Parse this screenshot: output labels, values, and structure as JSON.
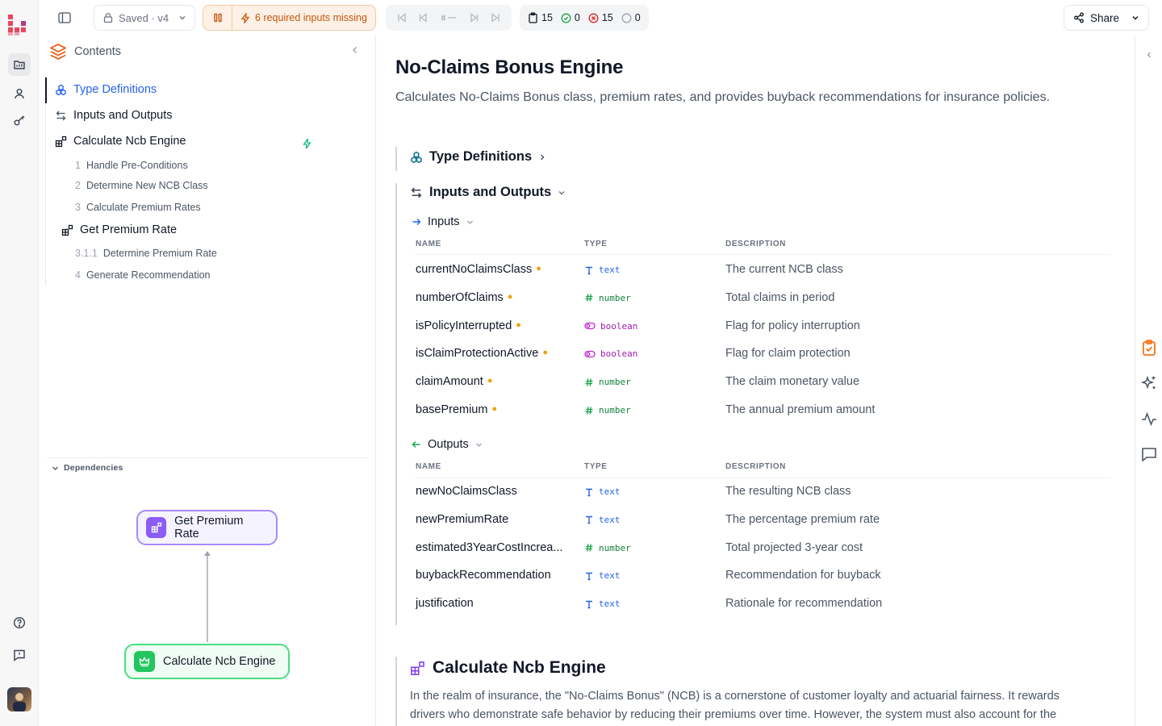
{
  "topbar": {
    "saved_label": "Saved · v4",
    "warning_label": "6 required inputs missing",
    "stats": {
      "total": "15",
      "passed": "0",
      "failed": "15",
      "pending": "0"
    },
    "share_label": "Share"
  },
  "contents": {
    "title": "Contents",
    "items": [
      {
        "label": "Type Definitions"
      },
      {
        "label": "Inputs and Outputs"
      },
      {
        "label": "Calculate Ncb Engine"
      },
      {
        "label": "Get Premium Rate"
      }
    ],
    "steps": [
      {
        "num": "1",
        "label": "Handle Pre-Conditions"
      },
      {
        "num": "2",
        "label": "Determine New NCB Class"
      },
      {
        "num": "3",
        "label": "Calculate Premium Rates"
      },
      {
        "num": "3.1.1",
        "label": "Determine Premium Rate"
      },
      {
        "num": "4",
        "label": "Generate Recommendation"
      }
    ]
  },
  "dependencies": {
    "title": "Dependencies",
    "nodes": [
      {
        "label": "Get Premium Rate"
      },
      {
        "label": "Calculate Ncb Engine"
      }
    ]
  },
  "main": {
    "title": "No-Claims Bonus Engine",
    "subtitle": "Calculates No-Claims Bonus class, premium rates, and provides buyback recommendations for insurance policies.",
    "type_definitions_label": "Type Definitions",
    "io_label": "Inputs and Outputs",
    "inputs_label": "Inputs",
    "outputs_label": "Outputs",
    "col_name": "NAME",
    "col_type": "TYPE",
    "col_desc": "DESCRIPTION",
    "inputs": [
      {
        "name": "currentNoClaimsClass",
        "type": "text",
        "desc": "The current NCB class"
      },
      {
        "name": "numberOfClaims",
        "type": "number",
        "desc": "Total claims in period"
      },
      {
        "name": "isPolicyInterrupted",
        "type": "boolean",
        "desc": "Flag for policy interruption"
      },
      {
        "name": "isClaimProtectionActive",
        "type": "boolean",
        "desc": "Flag for claim protection"
      },
      {
        "name": "claimAmount",
        "type": "number",
        "desc": "The claim monetary value"
      },
      {
        "name": "basePremium",
        "type": "number",
        "desc": "The annual premium amount"
      }
    ],
    "outputs": [
      {
        "name": "newNoClaimsClass",
        "type": "text",
        "desc": "The resulting NCB class"
      },
      {
        "name": "newPremiumRate",
        "type": "text",
        "desc": "The percentage premium rate"
      },
      {
        "name": "estimated3YearCostIncrea...",
        "type": "number",
        "desc": "Total projected 3-year cost"
      },
      {
        "name": "buybackRecommendation",
        "type": "text",
        "desc": "Recommendation for buyback"
      },
      {
        "name": "justification",
        "type": "text",
        "desc": "Rationale for recommendation"
      }
    ],
    "section_title": "Calculate Ncb Engine",
    "section_body": "In the realm of insurance, the \"No-Claims Bonus\" (NCB) is a cornerstone of customer loyalty and actuarial fairness. It rewards drivers who demonstrate safe behavior by reducing their premiums over time. However, the system must also account for the"
  },
  "colors": {
    "accent": "#2563eb",
    "warning": "#c2560c",
    "success": "#16a34a",
    "danger": "#dc2626",
    "brand": "#e8475f"
  }
}
